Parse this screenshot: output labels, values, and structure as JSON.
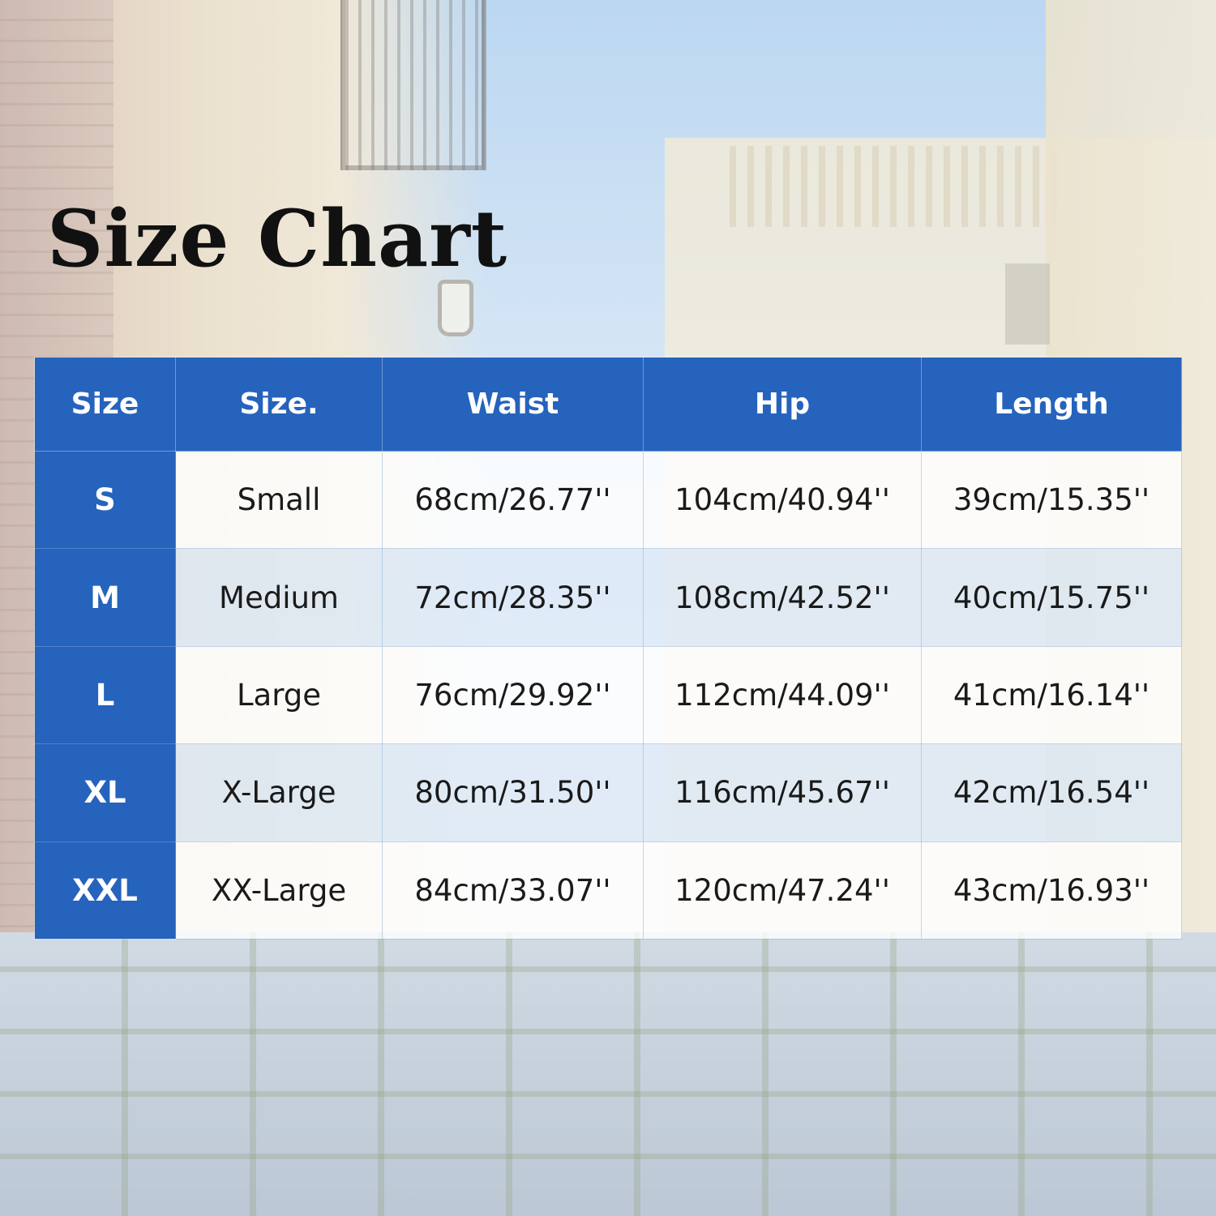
{
  "title": "Size Chart",
  "colors": {
    "header_blue": "#2563bd",
    "text_dark": "#1a1a1a"
  },
  "chart_data": {
    "type": "table",
    "title": "Size Chart",
    "columns": [
      "Size",
      "Size.",
      "Waist",
      "Hip",
      "Length"
    ],
    "rows": [
      [
        "S",
        "Small",
        "68cm/26.77''",
        "104cm/40.94''",
        "39cm/15.35''"
      ],
      [
        "M",
        "Medium",
        "72cm/28.35''",
        "108cm/42.52''",
        "40cm/15.75''"
      ],
      [
        "L",
        "Large",
        "76cm/29.92''",
        "112cm/44.09''",
        "41cm/16.14''"
      ],
      [
        "XL",
        "X-Large",
        "80cm/31.50''",
        "116cm/45.67''",
        "42cm/16.54''"
      ],
      [
        "XXL",
        "XX-Large",
        "84cm/33.07''",
        "120cm/47.24''",
        "43cm/16.93''"
      ]
    ]
  }
}
